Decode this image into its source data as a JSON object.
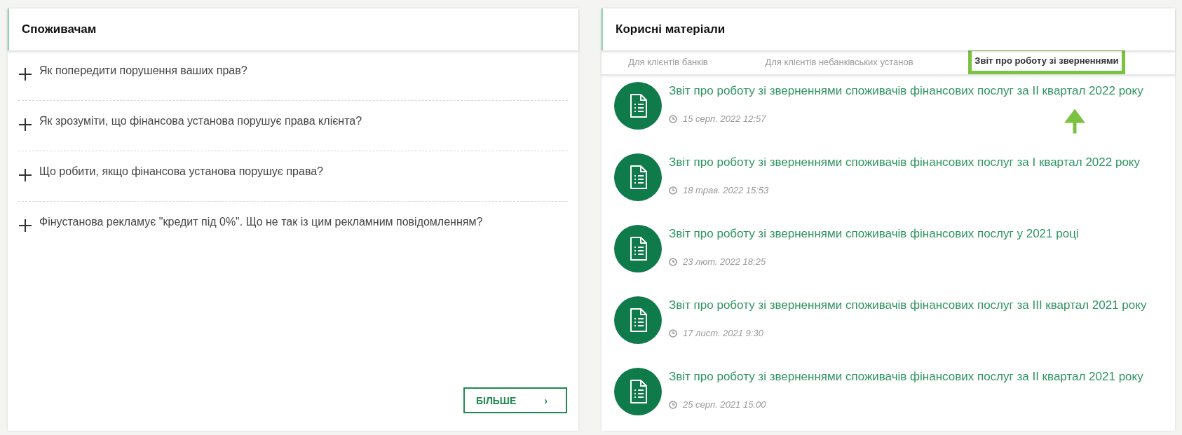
{
  "consumers": {
    "title": "Споживачам",
    "questions": [
      {
        "text": "Як попередити порушення ваших прав?",
        "expanded": false
      },
      {
        "text": "Як зрозуміти, що фінансова установа порушує права клієнта?",
        "expanded": false
      },
      {
        "text": "Що робити, якщо фінансова установа порушує права?",
        "expanded": false
      },
      {
        "text": "Фінустанова рекламує \"кредит під 0%\". Що не так із цим рекламним повідомленням?",
        "expanded": false
      }
    ],
    "more_button": {
      "label": "БІЛЬШЕ",
      "arrow": "›"
    }
  },
  "materials": {
    "title": "Корисні матеріали",
    "tabs": [
      {
        "label": "Для клієнтів банків",
        "selected": false,
        "highlighted": false
      },
      {
        "label": "Для клієнтів небанківських установ",
        "selected": false,
        "highlighted": false
      },
      {
        "label": "Звіт про роботу зі зверненнями",
        "selected": true,
        "highlighted": true
      }
    ],
    "documents": [
      {
        "title": "Звіт про роботу зі зверненнями споживачів фінансових послуг за II квартал 2022 року",
        "date": "15 серп. 2022 12:57"
      },
      {
        "title": "Звіт про роботу зі зверненнями споживачів фінансових послуг за I квартал 2022 року",
        "date": "18 трав. 2022 15:53"
      },
      {
        "title": "Звіт про роботу зі зверненнями споживачів фінансових послуг у 2021 році",
        "date": "23 лют. 2022 18:25"
      },
      {
        "title": "Звіт про роботу зі зверненнями споживачів фінансових послуг за III квартал 2021 року",
        "date": "17 лист. 2021 9:30"
      },
      {
        "title": "Звіт про роботу зі зверненнями споживачів фінансових послуг за II квартал 2021 року",
        "date": "25 серп. 2021 15:00"
      }
    ]
  }
}
